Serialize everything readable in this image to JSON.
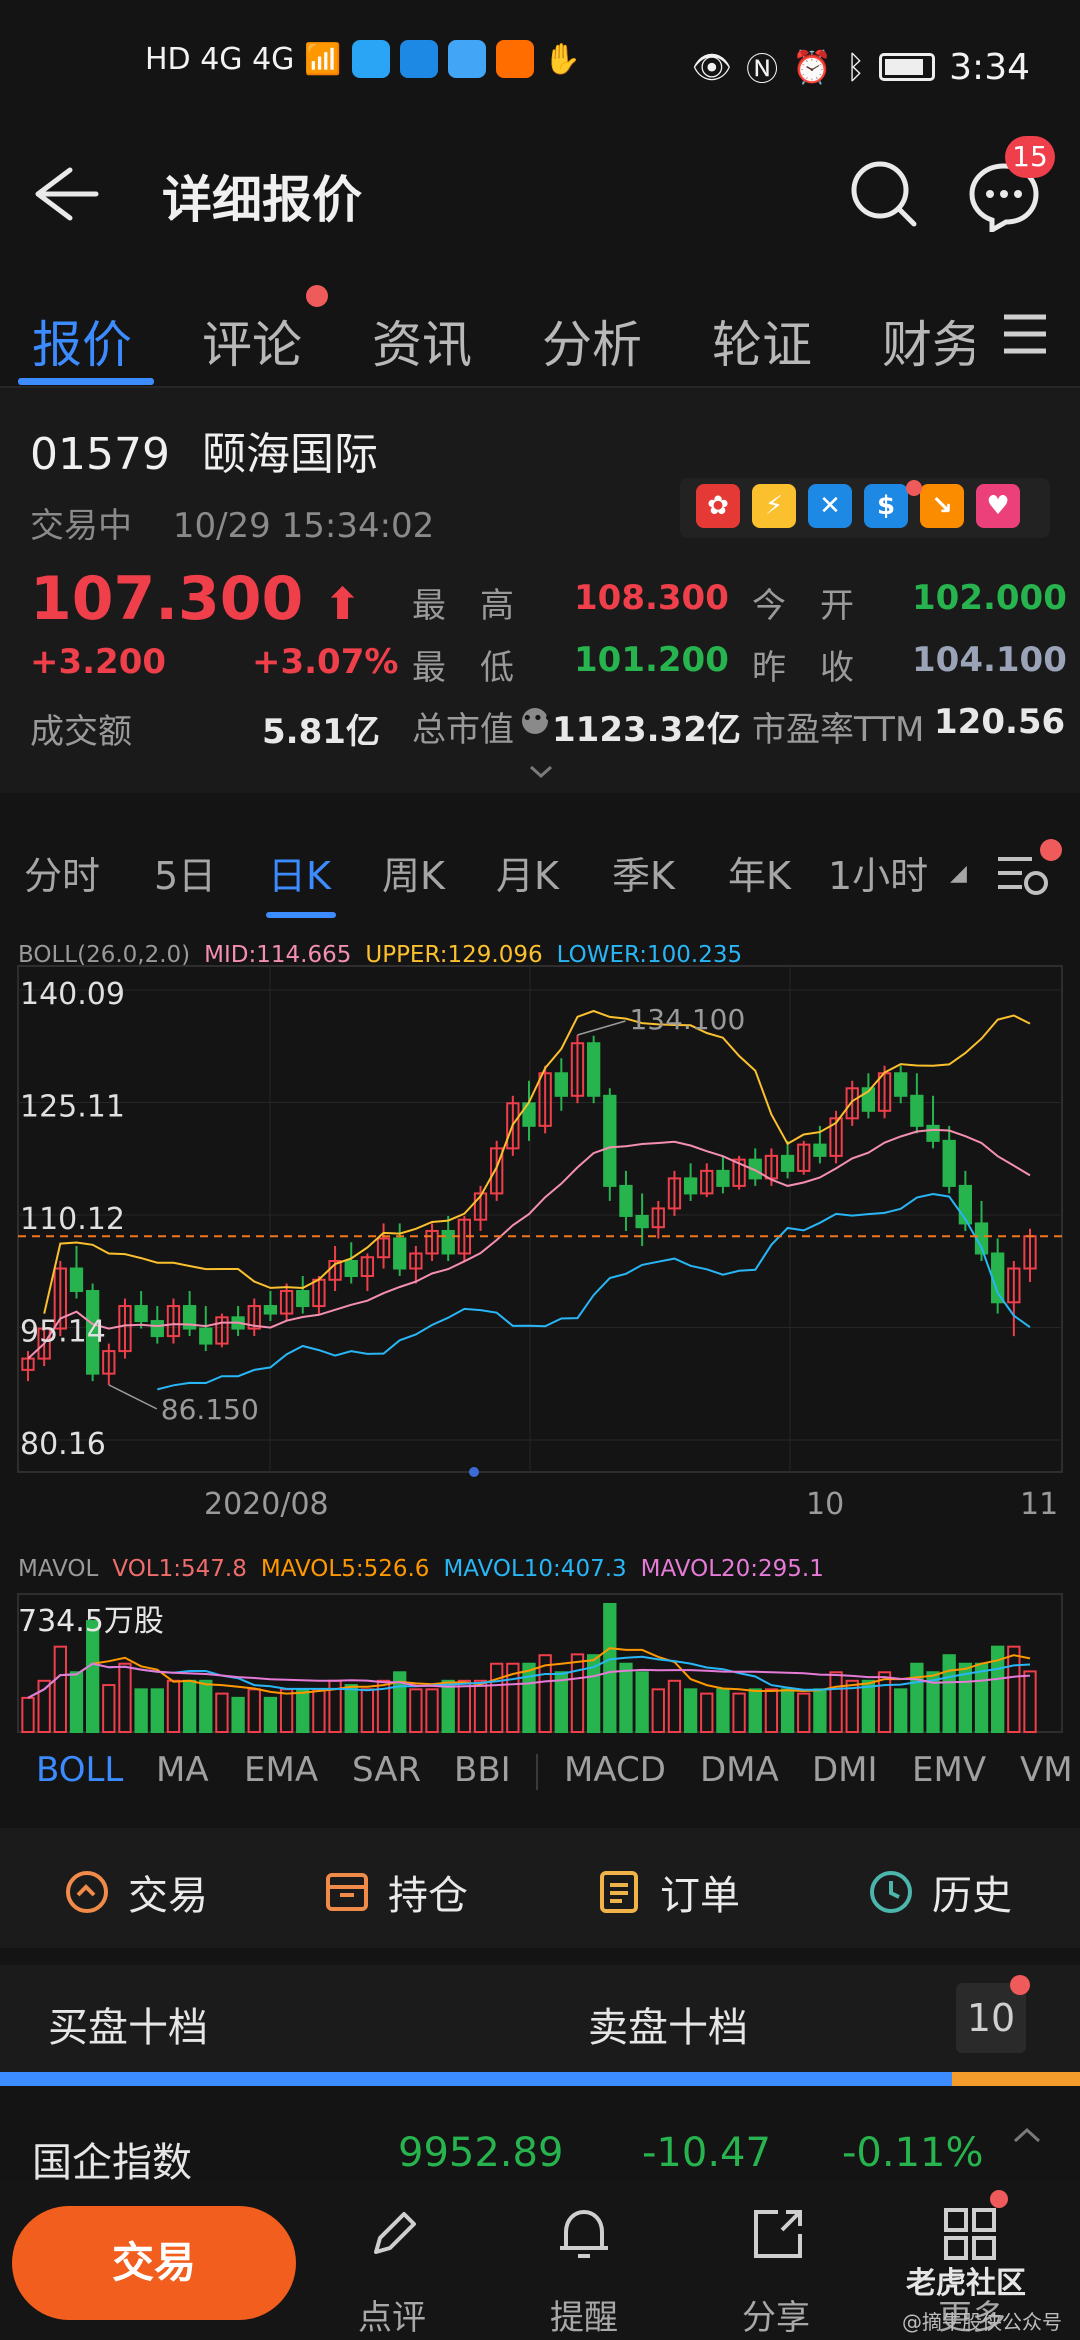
{
  "status_bar": {
    "left_text": "HD 4G 4G",
    "time": "3:34"
  },
  "header": {
    "title": "详细报价",
    "message_count": "15"
  },
  "tabs": [
    {
      "label": "报价",
      "active": true
    },
    {
      "label": "评论",
      "active": false
    },
    {
      "label": "资讯",
      "active": false
    },
    {
      "label": "分析",
      "active": false
    },
    {
      "label": "轮证",
      "active": false
    },
    {
      "label": "财务",
      "active": false
    }
  ],
  "stock": {
    "code": "01579",
    "name": "颐海国际",
    "status": "交易中",
    "datetime": "10/29 15:34:02",
    "price": "107.300",
    "change": "+3.200",
    "change_pct": "+3.07%",
    "turnover_label": "成交额",
    "turnover": "5.81亿"
  },
  "quote_grid": {
    "high_label": "最　高",
    "high": "108.300",
    "open_label": "今　开",
    "open": "102.000",
    "low_label": "最　低",
    "low": "101.200",
    "prev_label": "昨　收",
    "prev": "104.100",
    "mcap_label": "总市值",
    "mcap": "1123.32亿",
    "pe_label": "市盈率TTM",
    "pe": "120.56"
  },
  "kline_tabs": [
    {
      "label": "分时",
      "active": false
    },
    {
      "label": "5日",
      "active": false
    },
    {
      "label": "日K",
      "active": true
    },
    {
      "label": "周K",
      "active": false
    },
    {
      "label": "月K",
      "active": false
    },
    {
      "label": "季K",
      "active": false
    },
    {
      "label": "年K",
      "active": false
    },
    {
      "label": "1小时",
      "active": false
    }
  ],
  "boll_legend": {
    "name": "BOLL(26.0,2.0)",
    "mid": "MID:114.665",
    "upper": "UPPER:129.096",
    "lower": "LOWER:100.235"
  },
  "chart_data": {
    "type": "candlestick",
    "y_ticks": [
      "140.09",
      "125.11",
      "110.12",
      "95.14",
      "80.16"
    ],
    "x_ticks": [
      "2020/08",
      "10",
      "11"
    ],
    "annotations": {
      "high": "134.100",
      "low": "86.150"
    },
    "ylim": [
      80.16,
      140.09
    ],
    "current_price": 107.3,
    "candles": [
      [
        89.5,
        92.0,
        88.0,
        91.0
      ],
      [
        91.0,
        96.0,
        90.0,
        95.0
      ],
      [
        95.0,
        104.0,
        94.0,
        103.0
      ],
      [
        103.0,
        106.0,
        99.0,
        100.0
      ],
      [
        100.0,
        101.0,
        88.0,
        89.0
      ],
      [
        89.0,
        93.0,
        87.5,
        92.0
      ],
      [
        92.0,
        99.0,
        91.0,
        98.0
      ],
      [
        98.0,
        100.0,
        95.0,
        96.0
      ],
      [
        96.0,
        98.0,
        93.0,
        94.0
      ],
      [
        94.0,
        99.0,
        93.0,
        98.0
      ],
      [
        98.0,
        100.0,
        94.0,
        95.0
      ],
      [
        95.0,
        98.0,
        92.0,
        93.0
      ],
      [
        93.0,
        97.0,
        92.5,
        96.5
      ],
      [
        96.5,
        98.0,
        94.0,
        95.0
      ],
      [
        95.0,
        99.0,
        94.0,
        98.0
      ],
      [
        98.0,
        100.0,
        96.0,
        97.0
      ],
      [
        97.0,
        101.0,
        96.0,
        100.0
      ],
      [
        100.0,
        102.0,
        97.0,
        98.0
      ],
      [
        98.0,
        102.0,
        97.0,
        101.5
      ],
      [
        101.5,
        106.0,
        100.0,
        104.0
      ],
      [
        104.0,
        106.5,
        101.0,
        102.0
      ],
      [
        102.0,
        105.0,
        100.0,
        104.5
      ],
      [
        104.5,
        109.0,
        103.0,
        107.0
      ],
      [
        107.0,
        109.0,
        102.0,
        103.0
      ],
      [
        103.0,
        106.0,
        101.0,
        105.0
      ],
      [
        105.0,
        109.0,
        104.0,
        108.0
      ],
      [
        108.0,
        110.0,
        104.0,
        105.0
      ],
      [
        105.0,
        110.0,
        104.0,
        109.5
      ],
      [
        109.5,
        114.0,
        108.0,
        113.0
      ],
      [
        113.0,
        120.0,
        112.0,
        119.0
      ],
      [
        119.0,
        126.0,
        118.0,
        125.0
      ],
      [
        125.0,
        128.0,
        120.0,
        122.0
      ],
      [
        122.0,
        130.0,
        121.0,
        129.0
      ],
      [
        129.0,
        131.0,
        124.0,
        126.0
      ],
      [
        126.0,
        134.1,
        125.0,
        133.0
      ],
      [
        133.0,
        134.0,
        125.0,
        126.0
      ],
      [
        126.0,
        127.0,
        112.0,
        114.0
      ],
      [
        114.0,
        116.0,
        108.0,
        110.0
      ],
      [
        110.0,
        113.0,
        106.0,
        108.5
      ],
      [
        108.5,
        112.0,
        107.0,
        111.0
      ],
      [
        111.0,
        116.0,
        110.0,
        115.0
      ],
      [
        115.0,
        117.0,
        112.0,
        113.0
      ],
      [
        113.0,
        117.0,
        112.5,
        116.0
      ],
      [
        116.0,
        118.0,
        113.0,
        114.0
      ],
      [
        114.0,
        118.0,
        113.5,
        117.5
      ],
      [
        117.5,
        119.0,
        114.0,
        115.0
      ],
      [
        115.0,
        119.0,
        114.0,
        118.0
      ],
      [
        118.0,
        120.0,
        115.0,
        116.0
      ],
      [
        116.0,
        120.0,
        115.5,
        119.5
      ],
      [
        119.5,
        122.0,
        117.0,
        118.0
      ],
      [
        118.0,
        124.0,
        117.0,
        123.0
      ],
      [
        123.0,
        128.0,
        122.0,
        127.0
      ],
      [
        127.0,
        129.0,
        123.0,
        124.0
      ],
      [
        124.0,
        130.0,
        123.0,
        129.0
      ],
      [
        129.0,
        130.0,
        125.0,
        126.0
      ],
      [
        126.0,
        129.0,
        121.0,
        122.0
      ],
      [
        122.0,
        126.0,
        119.0,
        120.0
      ],
      [
        120.0,
        122.0,
        113.0,
        114.0
      ],
      [
        114.0,
        116.0,
        108.0,
        109.0
      ],
      [
        109.0,
        112.0,
        104.0,
        105.0
      ],
      [
        105.0,
        107.0,
        97.0,
        98.5
      ],
      [
        98.5,
        104.0,
        94.0,
        103.0
      ],
      [
        103.0,
        108.3,
        101.2,
        107.3
      ]
    ]
  },
  "mavol_legend": {
    "name": "MAVOL",
    "vol1": "VOL1:547.8",
    "mavol5": "MAVOL5:526.6",
    "mavol10": "MAVOL10:407.3",
    "mavol20": "MAVOL20:295.1",
    "max_label": "734.5万股"
  },
  "indicator_tabs": [
    {
      "label": "BOLL",
      "active": true
    },
    {
      "label": "MA",
      "active": false
    },
    {
      "label": "EMA",
      "active": false
    },
    {
      "label": "SAR",
      "active": false
    },
    {
      "label": "BBI",
      "active": false
    },
    {
      "label": "MACD",
      "active": false
    },
    {
      "label": "DMA",
      "active": false
    },
    {
      "label": "DMI",
      "active": false
    },
    {
      "label": "EMV",
      "active": false
    },
    {
      "label": "VM",
      "active": false
    }
  ],
  "actions": [
    {
      "label": "交易"
    },
    {
      "label": "持仓"
    },
    {
      "label": "订单"
    },
    {
      "label": "历史"
    }
  ],
  "order_book": {
    "buy_label": "买盘十档",
    "sell_label": "卖盘十档",
    "depth": "10"
  },
  "index_row": {
    "name": "国企指数",
    "value": "9952.89",
    "change": "-10.47",
    "change_pct": "-0.11%"
  },
  "bottom_nav": {
    "trade": "交易",
    "comment": "点评",
    "remind": "提醒",
    "share": "分享",
    "more": "更多",
    "watermark": "老虎社区",
    "watermark2": "@摘牛股侠公众号"
  }
}
